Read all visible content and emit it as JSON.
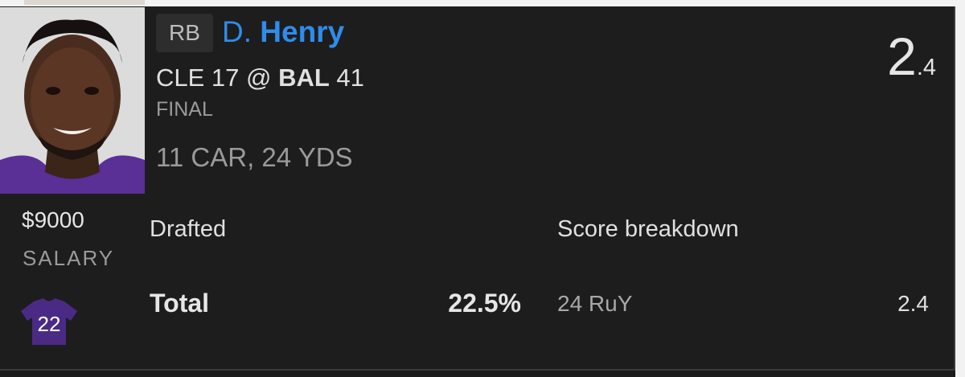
{
  "player": {
    "position": "RB",
    "first_initial": "D.",
    "last_name": "Henry",
    "game_away": "CLE 17 @ ",
    "game_home": "BAL",
    "game_home_score": " 41",
    "game_status": "FINAL",
    "stat_line": "11 CAR, 24 YDS",
    "points_int": "2",
    "points_dec": ".4",
    "salary": "$9000",
    "salary_label": "SALARY",
    "jersey_number": "22",
    "jersey_color": "#4b2a86"
  },
  "drafted": {
    "label": "Drafted",
    "total_label": "Total",
    "total_value": "22.5%"
  },
  "score_breakdown": {
    "label": "Score breakdown",
    "items": [
      {
        "stat": "24 RuY",
        "points": "2.4"
      }
    ]
  },
  "colors": {
    "name_blue": "#2f8ceb",
    "background": "#1d1d1d",
    "team_purple": "#4b2a86"
  }
}
